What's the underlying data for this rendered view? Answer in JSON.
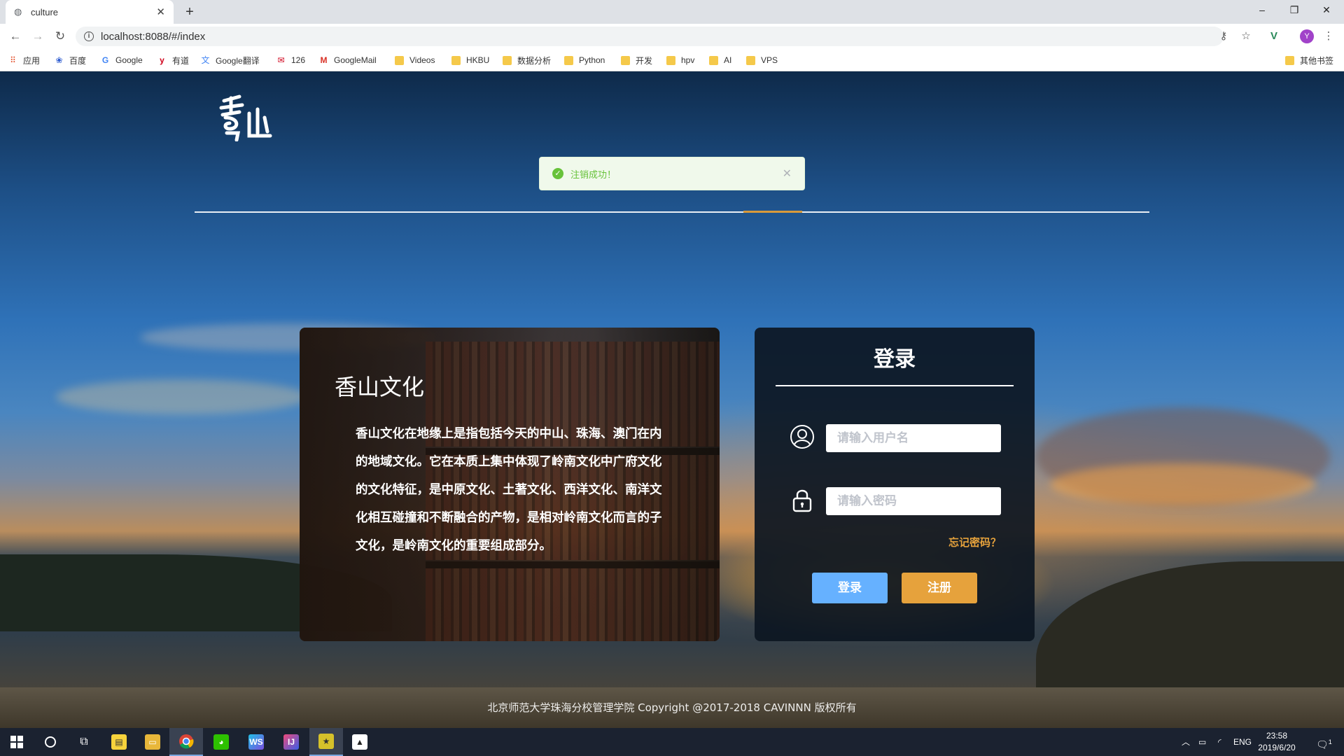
{
  "browser": {
    "tab_title": "culture",
    "url": "localhost:8088/#/index",
    "bookmarks": [
      "应用",
      "百度",
      "Google",
      "有道",
      "Google翻译",
      "126",
      "GoogleMail",
      "Videos",
      "HKBU",
      "数据分析",
      "Python",
      "开发",
      "hpv",
      "AI",
      "VPS"
    ],
    "other_bookmarks": "其他书签",
    "profile_initial": "Y"
  },
  "toast": {
    "message": "注销成功！",
    "type": "success"
  },
  "intro": {
    "title": "香山文化",
    "text": "香山文化在地缘上是指包括今天的中山、珠海、澳门在内的地域文化。它在本质上集中体现了岭南文化中广府文化的文化特征，是中原文化、土著文化、西洋文化、南洋文化相互碰撞和不断融合的产物，是相对岭南文化而言的子文化，是岭南文化的重要组成部分。"
  },
  "login": {
    "title": "登录",
    "username_placeholder": "请输入用户名",
    "password_placeholder": "请输入密码",
    "username_value": "",
    "password_value": "",
    "forgot": "忘记密码？",
    "login_button": "登录",
    "register_button": "注册"
  },
  "footer": "北京师范大学珠海分校管理学院 Copyright @2017-2018 CAVINNN 版权所有",
  "taskbar": {
    "language": "ENG",
    "time": "23:58",
    "date": "2019/6/20",
    "notifications": "1"
  },
  "colors": {
    "success": "#67c23a",
    "primary_button": "#66b1ff",
    "warning_button": "#e6a23c",
    "card_bg": "#0c1622"
  }
}
